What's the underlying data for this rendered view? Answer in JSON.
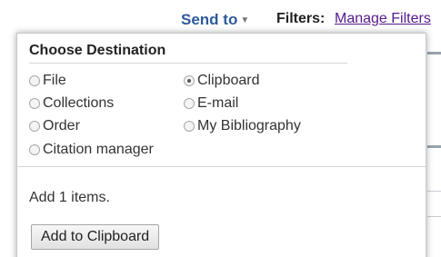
{
  "topbar": {
    "send_to_label": "Send to",
    "send_to_caret_icon": "chevron-down-icon",
    "filters_label": "Filters:",
    "filters_link": "Manage Filters"
  },
  "panel": {
    "title": "Choose Destination",
    "options": [
      {
        "label": "File",
        "selected": false
      },
      {
        "label": "Clipboard",
        "selected": true
      },
      {
        "label": "Collections",
        "selected": false
      },
      {
        "label": "E-mail",
        "selected": false
      },
      {
        "label": "Order",
        "selected": false
      },
      {
        "label": "My Bibliography",
        "selected": false
      },
      {
        "label": "Citation manager",
        "selected": false
      }
    ],
    "status_text": "Add 1 items.",
    "action_button": "Add to Clipboard"
  },
  "colors": {
    "send_to": "#2f5a9a",
    "link_visited": "#551a8b"
  }
}
